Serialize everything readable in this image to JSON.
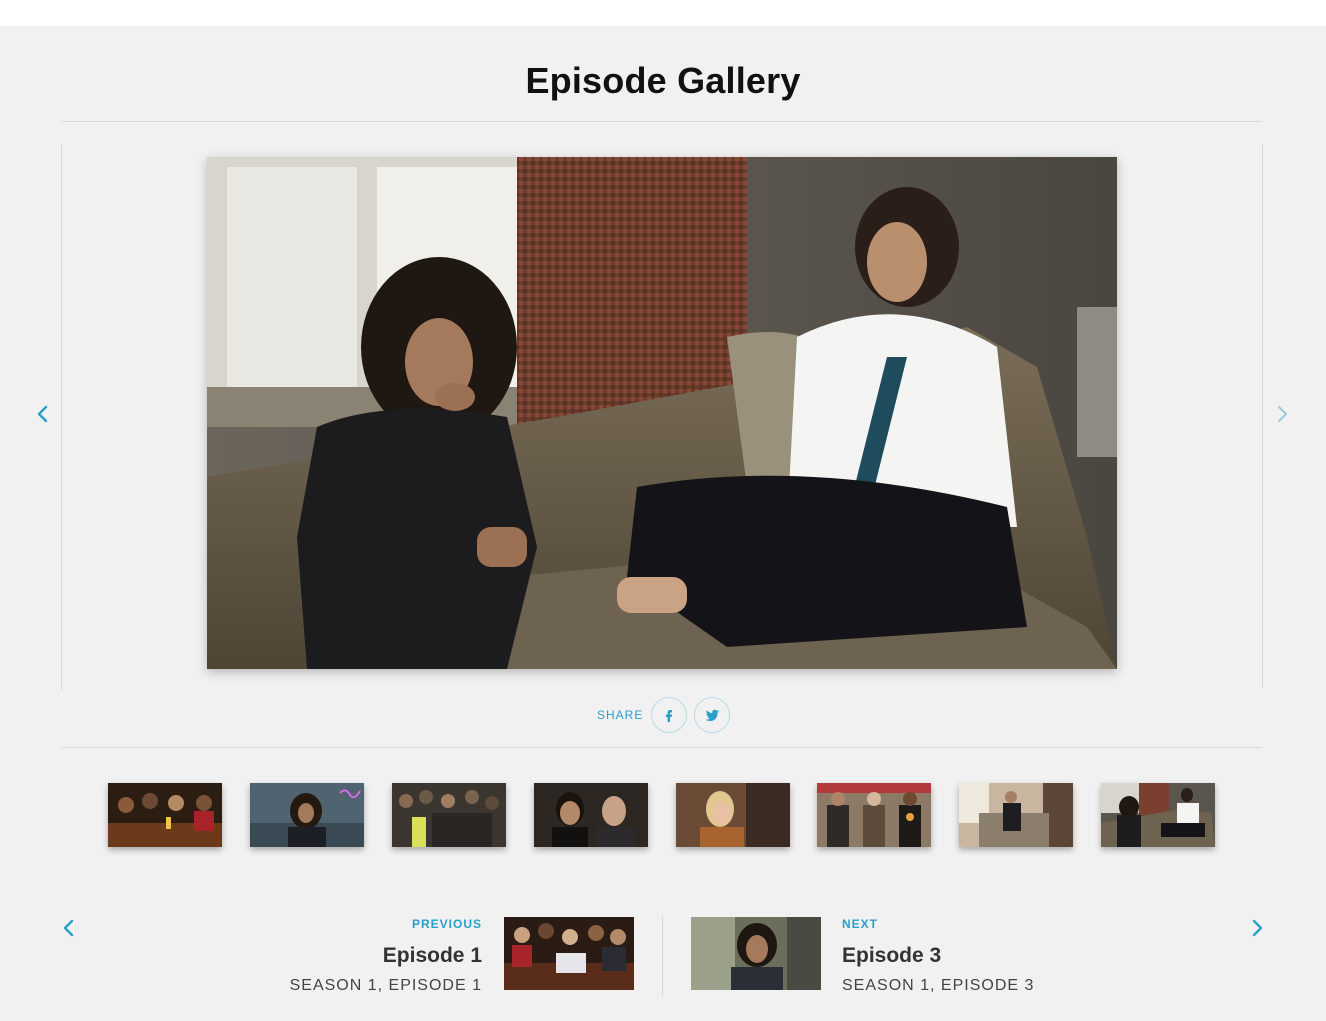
{
  "gallery": {
    "title": "Episode Gallery",
    "prev_icon": "chevron-left-icon",
    "next_icon": "chevron-right-icon",
    "accent_color": "#2a9fc9"
  },
  "share": {
    "label": "SHARE",
    "buttons": [
      "facebook-icon",
      "twitter-icon"
    ]
  },
  "thumbnails": {
    "count": 8,
    "selected_index": 7
  },
  "episode_nav": {
    "previous": {
      "tag": "PREVIOUS",
      "title": "Episode 1",
      "subtitle": "SEASON 1, EPISODE 1"
    },
    "next": {
      "tag": "NEXT",
      "title": "Episode 3",
      "subtitle": "SEASON 1, EPISODE 3"
    }
  }
}
